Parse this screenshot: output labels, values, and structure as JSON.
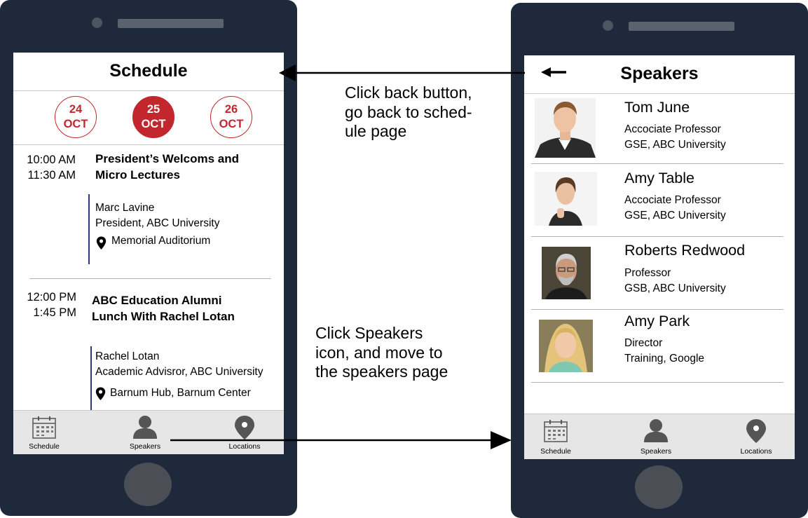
{
  "left_phone": {
    "header": "Schedule",
    "dates": [
      {
        "day": "24",
        "month": "OCT",
        "selected": false
      },
      {
        "day": "25",
        "month": "OCT",
        "selected": true
      },
      {
        "day": "26",
        "month": "OCT",
        "selected": false
      }
    ],
    "events": [
      {
        "start": "10:00 AM",
        "end": "11:30 AM",
        "title_line1": "President’s Welcoms and",
        "title_line2": "Micro Lectures",
        "speaker": "Marc Lavine",
        "role": "President, ABC University",
        "location": "Memorial Auditorium"
      },
      {
        "start": "12:00 PM",
        "end": "1:45 PM",
        "title_line1": "ABC Education Alumni",
        "title_line2": "Lunch With Rachel Lotan",
        "speaker": "Rachel Lotan",
        "role": "Academic Advisror, ABC University",
        "location": "Barnum Hub, Barnum Center"
      }
    ],
    "tabs": {
      "schedule": "Schedule",
      "speakers": "Speakers",
      "locations": "Locations"
    }
  },
  "right_phone": {
    "header": "Speakers",
    "speakers": [
      {
        "name": "Tom June",
        "title": "Accociate Professor",
        "org": "GSE, ABC University"
      },
      {
        "name": "Amy Table",
        "title": "Accociate Professor",
        "org": "GSE, ABC University"
      },
      {
        "name": "Roberts Redwood",
        "title": "Professor",
        "org": "GSB, ABC University"
      },
      {
        "name": "Amy Park",
        "title": "Director",
        "org": "Training, Google"
      }
    ],
    "tabs": {
      "schedule": "Schedule",
      "speakers": "Speakers",
      "locations": "Locations"
    }
  },
  "annotations": {
    "back_note": [
      "Click back button,",
      "go back to sched-",
      "ule page"
    ],
    "speakers_note": [
      "Click Speakers",
      "icon, and move to",
      "the speakers page"
    ]
  },
  "colors": {
    "phone_body": "#1e2a3b",
    "accent_red": "#c1272d",
    "tab_bar": "#e6e6e6",
    "divider_blue": "#2e3a7a"
  }
}
